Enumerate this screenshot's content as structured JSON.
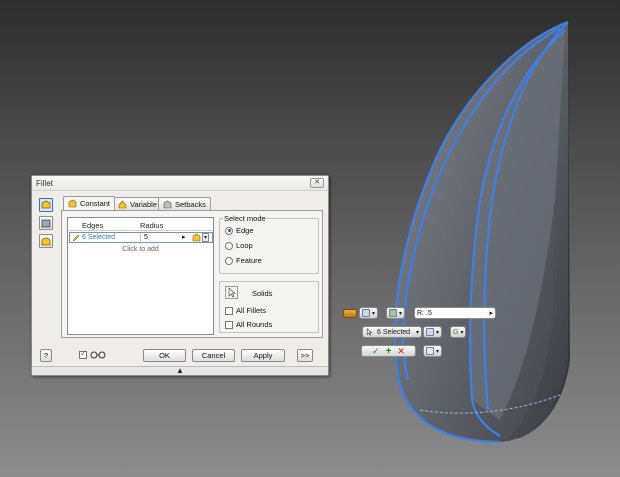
{
  "dialog": {
    "title": "Fillet",
    "close_glyph": "✕",
    "tabs": [
      {
        "label": "Constant"
      },
      {
        "label": "Variable"
      },
      {
        "label": "Setbacks"
      }
    ],
    "grid": {
      "col_edges": "Edges",
      "col_radius": "Radius",
      "row_edges": "6 Selected",
      "row_radius": "5",
      "click_to_add": "Click to add"
    },
    "select_mode": {
      "label": "Select mode",
      "options": [
        "Edge",
        "Loop",
        "Feature"
      ],
      "selected": "Edge"
    },
    "solids": {
      "label": "Solids",
      "all_fillets": "All Fillets",
      "all_rounds": "All Rounds"
    },
    "buttons": {
      "ok": "OK",
      "cancel": "Cancel",
      "apply": "Apply",
      "more": ">>",
      "help_glyph": "?"
    },
    "preview_checked": true
  },
  "minitoolbar": {
    "radius_label": "R:",
    "radius_value": ".5",
    "selection": "6 Selected"
  },
  "colors": {
    "edge_highlight": "#3f7fe6",
    "accent": "#2f7ad2"
  }
}
